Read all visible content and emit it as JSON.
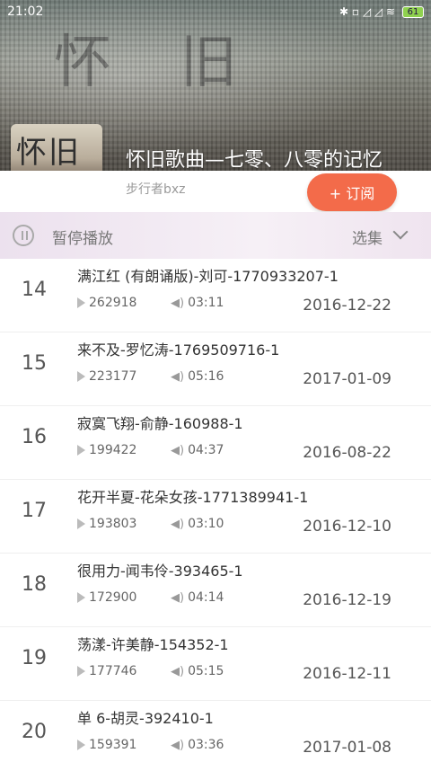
{
  "status": {
    "time": "21:02",
    "battery": "61",
    "signal": "✱ ▫ ◿ ◿ ≋"
  },
  "banner": {
    "bg_glyphs": "怀 旧"
  },
  "album": {
    "cover_text": "怀旧",
    "title": "怀旧歌曲—七零、八零的记忆",
    "author": "步行者bxz",
    "subscribe_label": "+ 订阅"
  },
  "playbar": {
    "play_label": "暂停播放",
    "episodes_label": "选集"
  },
  "tracks": [
    {
      "num": "14",
      "title": "满江红 (有朗诵版)-刘可-1770933207-1",
      "plays": "262918",
      "duration": "03:11",
      "date": "2016-12-22"
    },
    {
      "num": "15",
      "title": "来不及-罗忆涛-1769509716-1",
      "plays": "223177",
      "duration": "05:16",
      "date": "2017-01-09"
    },
    {
      "num": "16",
      "title": "寂寞飞翔-俞静-160988-1",
      "plays": "199422",
      "duration": "04:37",
      "date": "2016-08-22"
    },
    {
      "num": "17",
      "title": "花开半夏-花朵女孩-1771389941-1",
      "plays": "193803",
      "duration": "03:10",
      "date": "2016-12-10"
    },
    {
      "num": "18",
      "title": "很用力-闻韦伶-393465-1",
      "plays": "172900",
      "duration": "04:14",
      "date": "2016-12-19"
    },
    {
      "num": "19",
      "title": "荡漾-许美静-154352-1",
      "plays": "177746",
      "duration": "05:15",
      "date": "2016-12-11"
    },
    {
      "num": "20",
      "title": "单 6-胡灵-392410-1",
      "plays": "159391",
      "duration": "03:36",
      "date": "2017-01-08"
    }
  ]
}
